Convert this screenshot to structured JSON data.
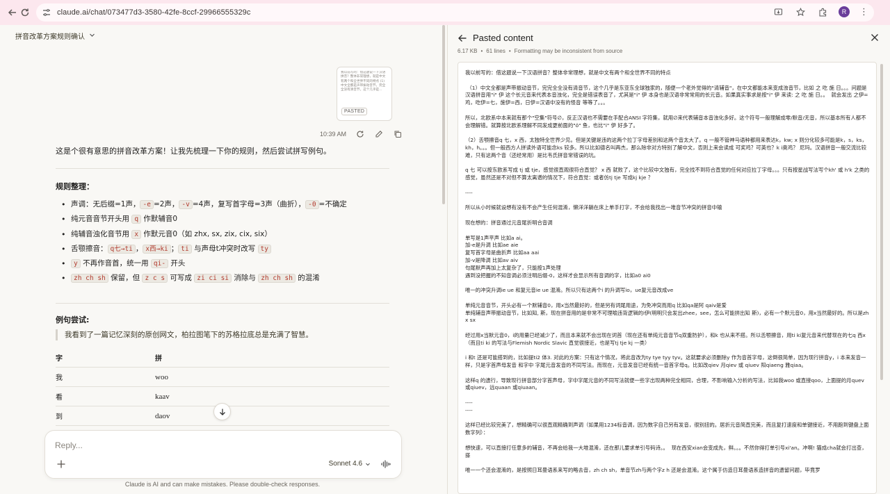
{
  "browser": {
    "url": "claude.ai/chat/073477d3-3580-42fe-8ccf-29966555329c",
    "profile_initial": "R"
  },
  "chat": {
    "title": "拼音改革方案规则确认",
    "pasted_card": {
      "preview": "我以前写的：借这题说一下汉语拼音？整体非常理想，就是中文有两个和全世界不同的特点 (1) 中文全都是声带振动音节，完全全没有清音节，这个几乎是...",
      "tag": "PASTED"
    },
    "message_time": "10:39 AM",
    "intro": "这是个很有意思的拼音改革方案！让我先梳理一下你的规则，然后尝试拼写例句。",
    "rules_heading": "规则整理：",
    "rules": [
      {
        "parts": [
          {
            "t": "声调：无后缀=1声，"
          },
          {
            "c": "-e"
          },
          {
            "t": "=2声，"
          },
          {
            "c": "-v"
          },
          {
            "t": "=4声，复写首字母=3声（曲折），"
          },
          {
            "c": "-0"
          },
          {
            "t": "=不确定"
          }
        ]
      },
      {
        "parts": [
          {
            "t": "纯元音音节开头用 "
          },
          {
            "c": "q"
          },
          {
            "t": " 作默辅音0"
          }
        ]
      },
      {
        "parts": [
          {
            "t": "纯辅音浊化音节用 "
          },
          {
            "c": "x"
          },
          {
            "t": " 作默元音0（如 zhx, sx, zix, cix, six）"
          }
        ]
      },
      {
        "parts": [
          {
            "t": "舌颚擦音："
          },
          {
            "c": "q七→ti"
          },
          {
            "t": "，"
          },
          {
            "c": "x西→ki"
          },
          {
            "t": "；"
          },
          {
            "c": "ti"
          },
          {
            "t": " 与声母t冲突时改写 "
          },
          {
            "c": "ty"
          }
        ]
      },
      {
        "parts": [
          {
            "c": "y"
          },
          {
            "t": " 不再作音首，统一用 "
          },
          {
            "c": "qi-"
          },
          {
            "t": " 开头"
          }
        ]
      },
      {
        "parts": [
          {
            "c": "zh ch sh"
          },
          {
            "t": " 保留，但 "
          },
          {
            "c": "z c s"
          },
          {
            "t": " 可写成 "
          },
          {
            "c": "zi ci si"
          },
          {
            "t": " 消除与 "
          },
          {
            "c": "zh ch sh"
          },
          {
            "t": " 的混淆"
          }
        ]
      }
    ],
    "try_heading": "例句尝试:",
    "quote": "我看到了一篇记忆深刻的原创网文，柏拉图笔下的苏格拉底总是充满了智慧。",
    "table": {
      "headers": [
        "字",
        "拼"
      ],
      "rows": [
        [
          "我",
          "woo"
        ],
        [
          "看",
          "kaav"
        ],
        [
          "到",
          "daov"
        ]
      ]
    },
    "composer_placeholder": "Reply...",
    "model": "Sonnet 4.6",
    "disclaimer": "Claude is AI and can make mistakes. Please double-check responses."
  },
  "paste_panel": {
    "title": "Pasted content",
    "size": "6.17 KB",
    "lines": "61 lines",
    "note": "Formatting may be inconsistent from source",
    "content": "我以前写的：借这题说一下汉语拼音？整体非常理想，就是中文有两个和全世界不同的特点\n\n （1）中文全都是声带振动音节，完完全全没有清音节，这个几乎是东亚东全球独家的，随便一个老外觉得的\"清辅音\"，在中文都能本来变成浊音节，比如 之 吃 施 日。。。问题是汉语拼音用\"i\" 伊 这个长元音来代表本音浊化，完全是错误表音了，尤其是\"i\" 伊 本身也是汉语非常常用的长元音。如果真实事求是按\"i\" 伊 来读: 之 吃 施 日。。  就会发出 之伊=鸡，吃伊=七，施伊=西，日伊=汉语中没有的怪音 等等了。。。\n\n所以，北欧系中本来就有那个\"空集\"符号∅，反正汉语也不需要在手配合ANSI 字符集，就用∅来代表辅音本音浊化多好。这个符号一般理解成零/默音/无音，所以基本所有人都不会理解错。就算按北欧系理解不同发成更前面的\"ö\" 鱼，也比\"i\" 伊 好多了。\n\n（2）舌颚擦音q 七，x 西，太独特全世界少见。但是关键是违的这两个拉丁字母差别和这两个音太大了。q 一般不管神马语种都用来表达k，kw; x 则分化较多可能是k，s，ks，kh，h。。。但一般西方人拼读外语可能念ks 较多。所以比如德名叫再杰，那么除非对方特别了解中文，否则上来会读成 可奖鸡？可英也？k i奥鸡？ 尼玛。汉语拼音一般交流比较难，只有这两个音（还经常用）是比韦氏拼音常错误的坑。\n\nq 七 可以按东欧系写成 tj 或 tje，感觉很直观很符合直觉？ x 西 就败了，这个比较中文独有，完全找不到符合直觉的任何对应拉丁字母。。。只有按星战写法写个kh' 或 h'k 之类的感觉，虽然还是不对但不算太离谱的情况下，符合直觉：或者仿tj tje 写成kj kje ？\n\n----\n\n所以从小时候就设想有没有不会产生任何混淆，懒洋洋躺在床上单手打字，不会给我找出一堆音节冲突的拼音中输\n\n现在想的：拼音通过元音尾折明合音调\n\n单写是1声平声 比如a ai。\n加-e是升调 比如ae aie\n复写首字母是曲折声 比如aa aai\n加-v是降调 比如av aiv\n句尾默声再加上太复杂了，只能按1声处理\n遇到没把握的不知音调必须注明后缀-0，这样才会显示所有音调的字，比如a0 ai0\n\n唯一的冲突升调ie ue 和复元音ie ue 混淆。所以只有这两个i 的升调写io，ue复元音改成ve\n\n单纯元音音节，开头必有一个默辅音0，用x当然最好的，但是另有词尾用途，为免冲突而用q 比如qa是阿 qaiv是爱\n单纯辅音声带振动音节，比如知, 斯，现在拼音用的是非常不可理喻违背逻辑的i伊(明明只会发出zhee，see，怎么可能拼出知 斯)，必有一个默元音0，用x当然最好的。所以是zhx sx\n\n经过用x当默元音0，i的用量已经减少了，而且本来就不会出现在词首（现在还有单纯元音音节q双重防护），和k 也从来不搭。所以舌颚擦音，用ti ki复元音来代替现在的七q 西x（而且ti ki 的写法与Flemish Nordic Slavic 直觉很接近，也是写tj tje kj 一类）\n\ni 和t 还是可能搭到的，比如提ti2 体3. 对此的方案：只有这个情况，将此音改为ty tye tyy tyv。这就要求必须删除y 作为音首字母，这倒很简单，因为现行拼音y，i 本来发音一样，只是字首声母发音 和字中 字尾元音发音的不同写法。而现在，元音发音已经有统一音首字母q。比如改qiev 月qiev 或 qiuev 阳qiaeng 雅qiaa。\n\n这样q 的遗行，导致现行拼音部分字首声母，字中字尾元音的不同写法就便一些字出现两种完全相同，合理，不影响输入分析的写法，比如我woo 或直接qoo，上面提的月quev 或qiuev，远quaan 或qiuaan。\n\n----\n----\n\n这样已经比较完美了，想精确可以很直观精确到声调（如果用1234标音调，因为数字自己另有发音，很别扭的。居折元音简直完美，而且复打速度和单键接近，不用跑到键盘上面数字列）：\n\n想快速，可以直接打任意多的辅音，不再会给我一大堆混淆，还在那儿要求单引号码诗。。  现在西安xian会变成先，鲜。。。不然你得打单引号xi'an。冲啊! 猫成cha就会打出查，搽\n\n唯一一个还会混淆的，是按照日耳曼语系来写的略去音，zh ch sh，单音节zh与两个字z h 还是会混淆。这个属于仿造日耳曼语系造拼音的遗留问题，毕竟罗"
  }
}
